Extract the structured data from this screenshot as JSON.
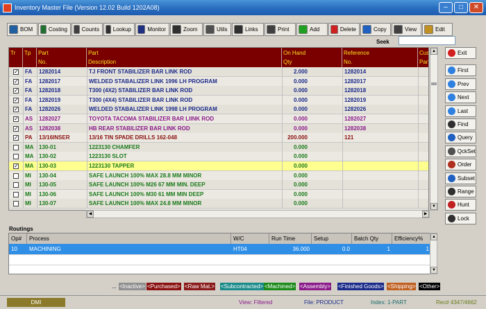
{
  "window": {
    "title": "Inventory Master File    (Version 12.02  Build 1202A08)",
    "controls": [
      "minimize",
      "maximize",
      "close"
    ]
  },
  "toolbar": [
    {
      "label": "BOM",
      "icon": "bom-icon",
      "color": "#2060a0"
    },
    {
      "label": "Costing",
      "icon": "money-bag-icon",
      "color": "#207030"
    },
    {
      "label": "Counts",
      "icon": "counts-icon",
      "color": "#404040"
    },
    {
      "label": "Lookup",
      "icon": "magnifier-icon",
      "color": "#303030"
    },
    {
      "label": "Monitor",
      "icon": "monitor-icon",
      "color": "#203080"
    },
    {
      "label": "Zoom",
      "icon": "zoom-icon",
      "color": "#303030"
    },
    {
      "label": "Utils",
      "icon": "wrench-icon",
      "color": "#505050"
    },
    {
      "label": "Links",
      "icon": "link-icon",
      "color": "#303030"
    },
    {
      "label": "Print",
      "icon": "printer-icon",
      "color": "#404040"
    },
    {
      "label": "Add",
      "icon": "plus-icon",
      "color": "#20a020"
    },
    {
      "label": "Delete",
      "icon": "minus-icon",
      "color": "#d02020"
    },
    {
      "label": "Copy",
      "icon": "copy-icon",
      "color": "#2060c0"
    },
    {
      "label": "View",
      "icon": "view-icon",
      "color": "#404040"
    },
    {
      "label": "Edit",
      "icon": "edit-icon",
      "color": "#c09020"
    }
  ],
  "seek": {
    "label": "Seek",
    "value": ""
  },
  "grid": {
    "headers": [
      {
        "line1": "Tr",
        "line2": ""
      },
      {
        "line1": "Tp",
        "line2": ""
      },
      {
        "line1": "Part",
        "line2": "No."
      },
      {
        "line1": "Part",
        "line2": "Description"
      },
      {
        "line1": "On Hand",
        "line2": "Qty"
      },
      {
        "line1": "Reference",
        "line2": "No."
      },
      {
        "line1": "Cus",
        "line2": "Part"
      }
    ],
    "rows": [
      {
        "checked": true,
        "tp": "FA",
        "part": "1282014",
        "desc": "TJ FRONT STABILIZER BAR LINK ROD",
        "qty": "2.000",
        "ref": "1282014",
        "color": "#1a2a8a"
      },
      {
        "checked": true,
        "tp": "FA",
        "part": "1282017",
        "desc": "WELDED STABALIZER LINK 1996 LH PROGRAM",
        "qty": "0.000",
        "ref": "1282017",
        "color": "#1a2a8a"
      },
      {
        "checked": true,
        "tp": "FA",
        "part": "1282018",
        "desc": "T300 (4X2) STABILIZER BAR LINK ROD",
        "qty": "0.000",
        "ref": "1282018",
        "color": "#1a2a8a"
      },
      {
        "checked": true,
        "tp": "FA",
        "part": "1282019",
        "desc": "T300 (4X4) STABILIZER BAR LINK ROD",
        "qty": "0.000",
        "ref": "1282019",
        "color": "#1a2a8a"
      },
      {
        "checked": true,
        "tp": "FA",
        "part": "1282026",
        "desc": "WELDED STABALIZER LINK 1998 LH PROGRAM",
        "qty": "0.000",
        "ref": "1282026",
        "color": "#1a2a8a"
      },
      {
        "checked": true,
        "tp": "AS",
        "part": "1282027",
        "desc": "TOYOTA TACOMA STABILIZER BAR LIINK ROD",
        "qty": "0.000",
        "ref": "1282027",
        "color": "#8a1a8a"
      },
      {
        "checked": true,
        "tp": "AS",
        "part": "1282038",
        "desc": "HB REAR STABILIZER BAR LINK ROD",
        "qty": "0.000",
        "ref": "1282038",
        "color": "#8a1a8a"
      },
      {
        "checked": true,
        "tp": "PA",
        "part": "13/16INSER",
        "desc": "13/16 TIN SPADE DRILLS 162-048",
        "qty": "200.000",
        "ref": "121",
        "color": "#8a1010"
      },
      {
        "checked": false,
        "tp": "MA",
        "part": "130-01",
        "desc": "1223130 CHAMFER",
        "qty": "0.000",
        "ref": "",
        "color": "#1a7a1a"
      },
      {
        "checked": false,
        "tp": "MA",
        "part": "130-02",
        "desc": "1223130 SLOT",
        "qty": "0.000",
        "ref": "",
        "color": "#1a7a1a"
      },
      {
        "checked": true,
        "tp": "MA",
        "part": "130-03",
        "desc": "1223130 TAPPER",
        "qty": "0.000",
        "ref": "",
        "color": "#1a7a1a",
        "selected": true
      },
      {
        "checked": false,
        "tp": "MI",
        "part": "130-04",
        "desc": "SAFE LAUNCH 100% MAX 28.8 MM MINOR",
        "qty": "0.000",
        "ref": "",
        "color": "#1a7a1a"
      },
      {
        "checked": false,
        "tp": "MI",
        "part": "130-05",
        "desc": "SAFE LAUNCH 100% M26 67 MM MIN. DEEP",
        "qty": "0.000",
        "ref": "",
        "color": "#1a7a1a"
      },
      {
        "checked": false,
        "tp": "MI",
        "part": "130-06",
        "desc": "SAFE LAUNCH 100% M30 61 MM MIN DEEP",
        "qty": "0.000",
        "ref": "",
        "color": "#1a7a1a"
      },
      {
        "checked": false,
        "tp": "MI",
        "part": "130-07",
        "desc": "SAFE LAUNCH 100% MAX 24.8 MM MINOR",
        "qty": "0.000",
        "ref": "",
        "color": "#1a7a1a"
      }
    ]
  },
  "sidebar": [
    {
      "label": "Exit",
      "icon": "exit-icon",
      "color": "#d02020",
      "gap": false
    },
    {
      "label": "First",
      "icon": "first-icon",
      "color": "#3080e0",
      "gap": true
    },
    {
      "label": "Prev",
      "icon": "prev-icon",
      "color": "#3080e0",
      "gap": false
    },
    {
      "label": "Next",
      "icon": "next-icon",
      "color": "#3080e0",
      "gap": false
    },
    {
      "label": "Last",
      "icon": "last-icon",
      "color": "#3080e0",
      "gap": false
    },
    {
      "label": "Find",
      "icon": "find-icon",
      "color": "#303030",
      "gap": false
    },
    {
      "label": "Query",
      "icon": "query-icon",
      "color": "#2060c0",
      "gap": false
    },
    {
      "label": "QckSet",
      "icon": "quickset-icon",
      "color": "#505050",
      "gap": false
    },
    {
      "label": "Order",
      "icon": "order-icon",
      "color": "#b03020",
      "gap": false
    },
    {
      "label": "Subset",
      "icon": "subset-icon",
      "color": "#2060c0",
      "gap": false
    },
    {
      "label": "Range",
      "icon": "range-icon",
      "color": "#303030",
      "gap": false
    },
    {
      "label": "Hunt",
      "icon": "hunt-icon",
      "color": "#c02020",
      "gap": false
    },
    {
      "label": "Lock",
      "icon": "lock-icon",
      "color": "#303030",
      "gap": false
    }
  ],
  "routings": {
    "label": "Routings",
    "headers": [
      "Op#",
      "Process",
      "W/C",
      "Run Time",
      "Setup",
      "Batch Qty",
      "Efficiency%"
    ],
    "rows": [
      {
        "op": "10",
        "process": "MACHINING",
        "wc": "HT04",
        "run": "36.000",
        "setup": "0.0",
        "batch": "1",
        "eff": "1"
      }
    ]
  },
  "legend": {
    "prefix": "...",
    "items": [
      {
        "label": "<Inactive>",
        "color": "#909090"
      },
      {
        "label": "<Purchased>",
        "color": "#8a1010"
      },
      {
        "label": "<Raw Mat.>",
        "color": "#8a1a1a"
      },
      {
        "label": "<Subcontracted>",
        "color": "#1a8a8a"
      },
      {
        "label": "<Machined>",
        "color": "#1a8a1a"
      },
      {
        "label": "<Assembly>",
        "color": "#8a1a8a"
      },
      {
        "label": "<Finished Goods>",
        "color": "#1a2a8a"
      },
      {
        "label": "<Shipping>",
        "color": "#c06020"
      },
      {
        "label": "<Other>",
        "color": "#000000"
      }
    ]
  },
  "status": {
    "user": "DMI",
    "view": "View: Filtered",
    "file": "File: PRODUCT",
    "index": "Index: 1-PART",
    "rec": "Rec# 4347/4662"
  }
}
